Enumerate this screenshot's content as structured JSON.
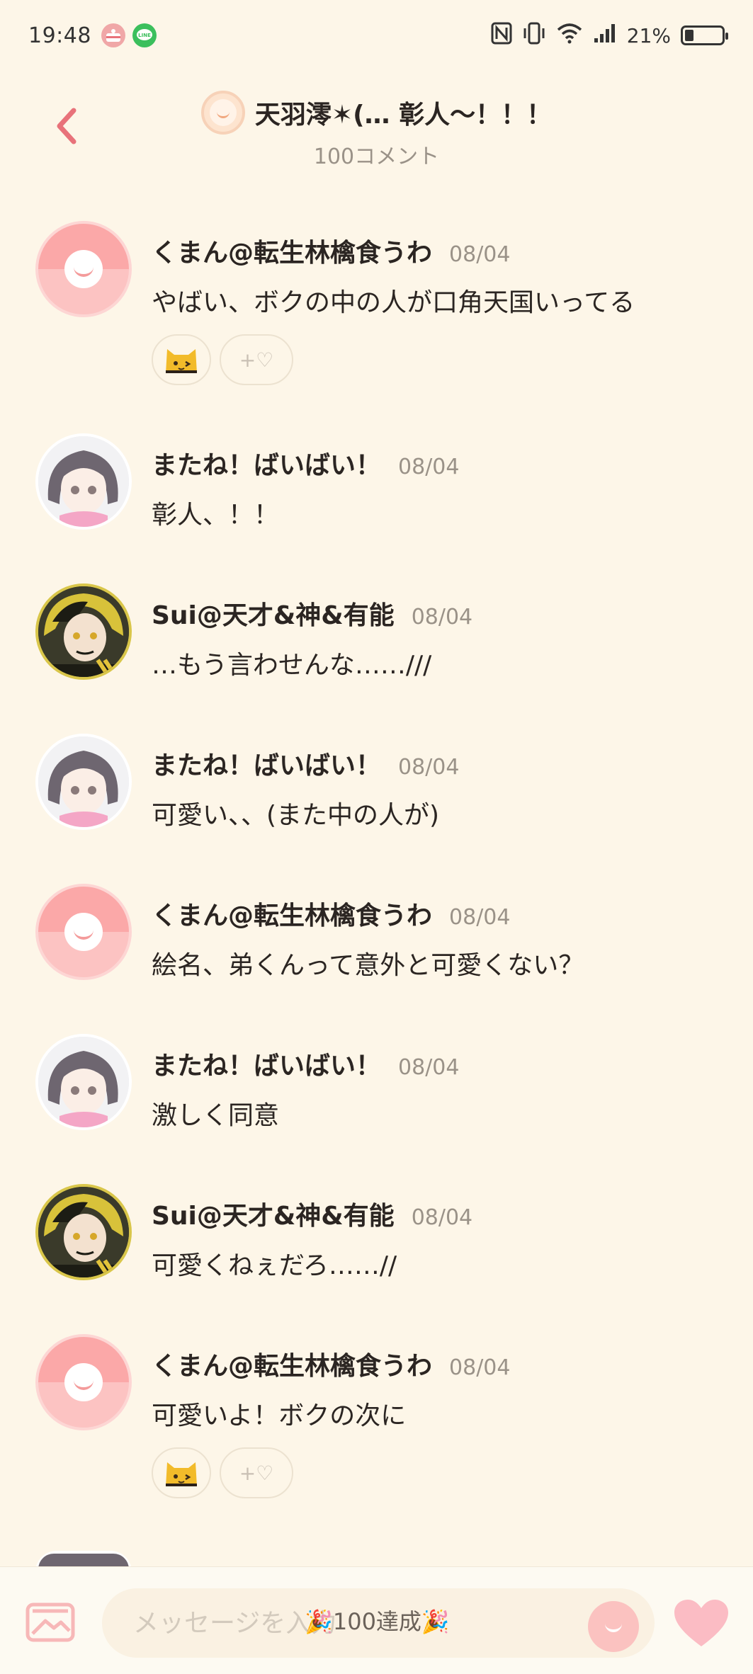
{
  "status_bar": {
    "time": "19:48",
    "battery_percent": "21%",
    "battery_level": 0.21,
    "icons": [
      "cake-app-icon",
      "line-app-icon",
      "nfc-icon",
      "vibrate-icon",
      "wifi-icon",
      "signal-icon",
      "battery-icon"
    ]
  },
  "header": {
    "title": "天羽澪✶(… 彰人〜！！！",
    "subtitle": "100コメント"
  },
  "comments": [
    {
      "author": "くまん@転生林檎食うわ",
      "date": "08/04",
      "message": "やばい、ボクの中の人が口角天国いってる",
      "avatar": "default",
      "reaction_add": "+♡"
    },
    {
      "author": "またね！ばいばい！",
      "date": "08/04",
      "message": "彰人、！！",
      "avatar": "girl"
    },
    {
      "author": "Sui@天才&神&有能",
      "date": "08/04",
      "message": "…もう言わせんな……///",
      "avatar": "boy"
    },
    {
      "author": "またね！ばいばい！",
      "date": "08/04",
      "message": "可愛い、、(また中の人が)",
      "avatar": "girl"
    },
    {
      "author": "くまん@転生林檎食うわ",
      "date": "08/04",
      "message": "絵名、弟くんって意外と可愛くない？",
      "avatar": "default"
    },
    {
      "author": "またね！ばいばい！",
      "date": "08/04",
      "message": "激しく同意",
      "avatar": "girl"
    },
    {
      "author": "Sui@天才&神&有能",
      "date": "08/04",
      "message": "可愛くねぇだろ……//",
      "avatar": "boy"
    },
    {
      "author": "くまん@転生林檎食うわ",
      "date": "08/04",
      "message": "可愛いよ！ボクの次に",
      "avatar": "default",
      "reaction_add": "+♡"
    }
  ],
  "bottom_bar": {
    "input_placeholder": "メッセージを入力",
    "achievement": "🎉100達成🎉"
  },
  "colors": {
    "background": "#fdf6e8",
    "accent_pink": "#e8727a",
    "default_avatar_pink": "#fba8a8"
  }
}
